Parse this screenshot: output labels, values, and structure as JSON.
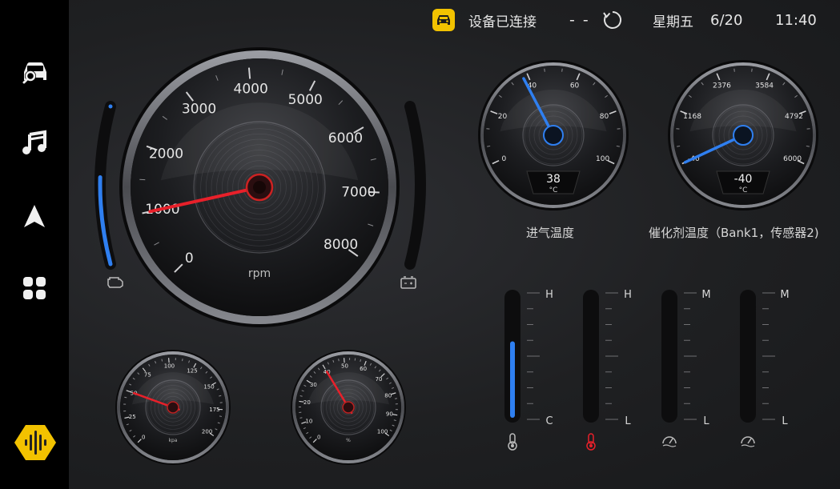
{
  "status": {
    "connection": "设备已连接",
    "dashes": "- -",
    "weekday": "星期五",
    "date": "6/20",
    "time": "11:40"
  },
  "sidebar": {
    "items": [
      {
        "icon": "car-diagnostic-icon"
      },
      {
        "icon": "music-icon"
      },
      {
        "icon": "navigation-icon"
      },
      {
        "icon": "apps-grid-icon"
      },
      {
        "icon": "voice-assistant-icon"
      }
    ]
  },
  "rpm_gauge": {
    "unit": "rpm",
    "ticks": [
      "0",
      "1000",
      "2000",
      "3000",
      "4000",
      "5000",
      "6000",
      "7000",
      "8000"
    ],
    "value": 1000
  },
  "side_bars": {
    "left_level": 0.55,
    "right_level": 0
  },
  "small_gauges": {
    "kpa": {
      "ticks": [
        "0",
        "25",
        "50",
        "75",
        "100",
        "125",
        "150",
        "175",
        "200"
      ],
      "unit": "kpa",
      "value": 50
    },
    "percent": {
      "ticks": [
        "0",
        "10",
        "20",
        "30",
        "40",
        "50",
        "60",
        "70",
        "80",
        "90",
        "100"
      ],
      "unit": "%",
      "value": 40
    }
  },
  "intake_temp": {
    "ticks": [
      "0",
      "20",
      "40",
      "60",
      "80",
      "100"
    ],
    "value": "38",
    "unit": "°C",
    "label": "进气温度"
  },
  "catalyst_temp": {
    "ticks": [
      "-40",
      "1168",
      "2376",
      "3584",
      "4792",
      "6000"
    ],
    "value": "-40",
    "unit": "°C",
    "label": "催化剂温度（Bank1，传感器2)"
  },
  "vertical_meters": [
    {
      "top": "H",
      "bottom": "C",
      "level": 0.62,
      "color": "#2f7ff0"
    },
    {
      "top": "H",
      "bottom": "L",
      "level": 0,
      "color": "#2f7ff0"
    },
    {
      "top": "M",
      "bottom": "L",
      "level": 0,
      "color": "#2f7ff0"
    },
    {
      "top": "M",
      "bottom": "L",
      "level": 0,
      "color": "#2f7ff0"
    }
  ],
  "colors": {
    "accent_blue": "#2f7ff0",
    "needle_red": "#e8202a",
    "status_yellow": "#f2c200"
  }
}
